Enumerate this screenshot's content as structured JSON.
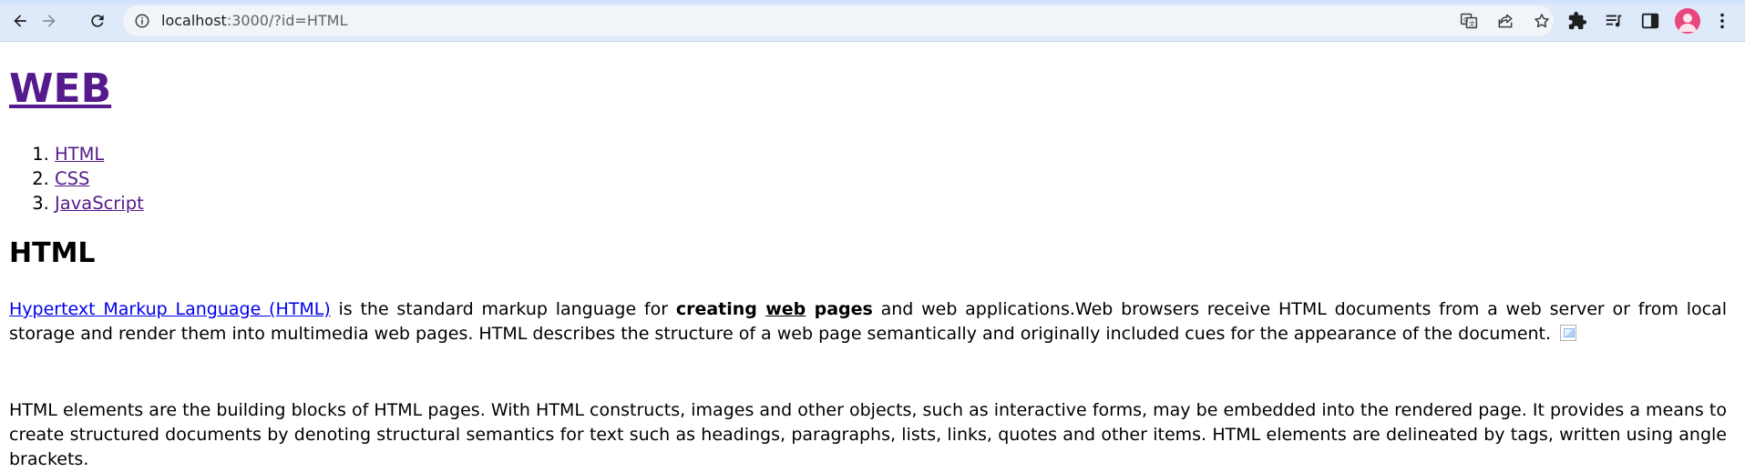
{
  "browser": {
    "url_host": "localhost",
    "url_rest": ":3000/?id=HTML",
    "icons": [
      "back-icon",
      "forward-icon",
      "reload-icon",
      "info-icon",
      "translate-icon",
      "share-icon",
      "star-icon",
      "extensions-icon",
      "reading-list-icon",
      "side-panel-icon",
      "avatar",
      "menu-icon"
    ]
  },
  "site": {
    "title": "WEB",
    "nav": [
      {
        "label": "HTML"
      },
      {
        "label": "CSS"
      },
      {
        "label": "JavaScript"
      }
    ]
  },
  "article": {
    "heading": "HTML",
    "p1_link": "Hypertext Markup Language (HTML)",
    "p1_text_a": " is the standard markup language for ",
    "p1_bold_a": "creating ",
    "p1_bold_u": "web",
    "p1_bold_b": " pages",
    "p1_text_b": " and web applications.Web browsers receive HTML documents from a web server or from local storage and render them into multimedia web pages. HTML describes the structure of a web page semantically and originally included cues for the appearance of the document.",
    "p2": "HTML elements are the building blocks of HTML pages. With HTML constructs, images and other objects, such as interactive forms, may be embedded into the rendered page. It provides a means to create structured documents by denoting structural semantics for text such as headings, paragraphs, lists, links, quotes and other items. HTML elements are delineated by tags, written using angle brackets."
  },
  "colors": {
    "chrome_bg": "#dee9f9",
    "omnibox_bg": "#f1f4f9",
    "visited_link": "#551a8b",
    "link": "#0000ee",
    "avatar_bg": "#e8467c"
  }
}
